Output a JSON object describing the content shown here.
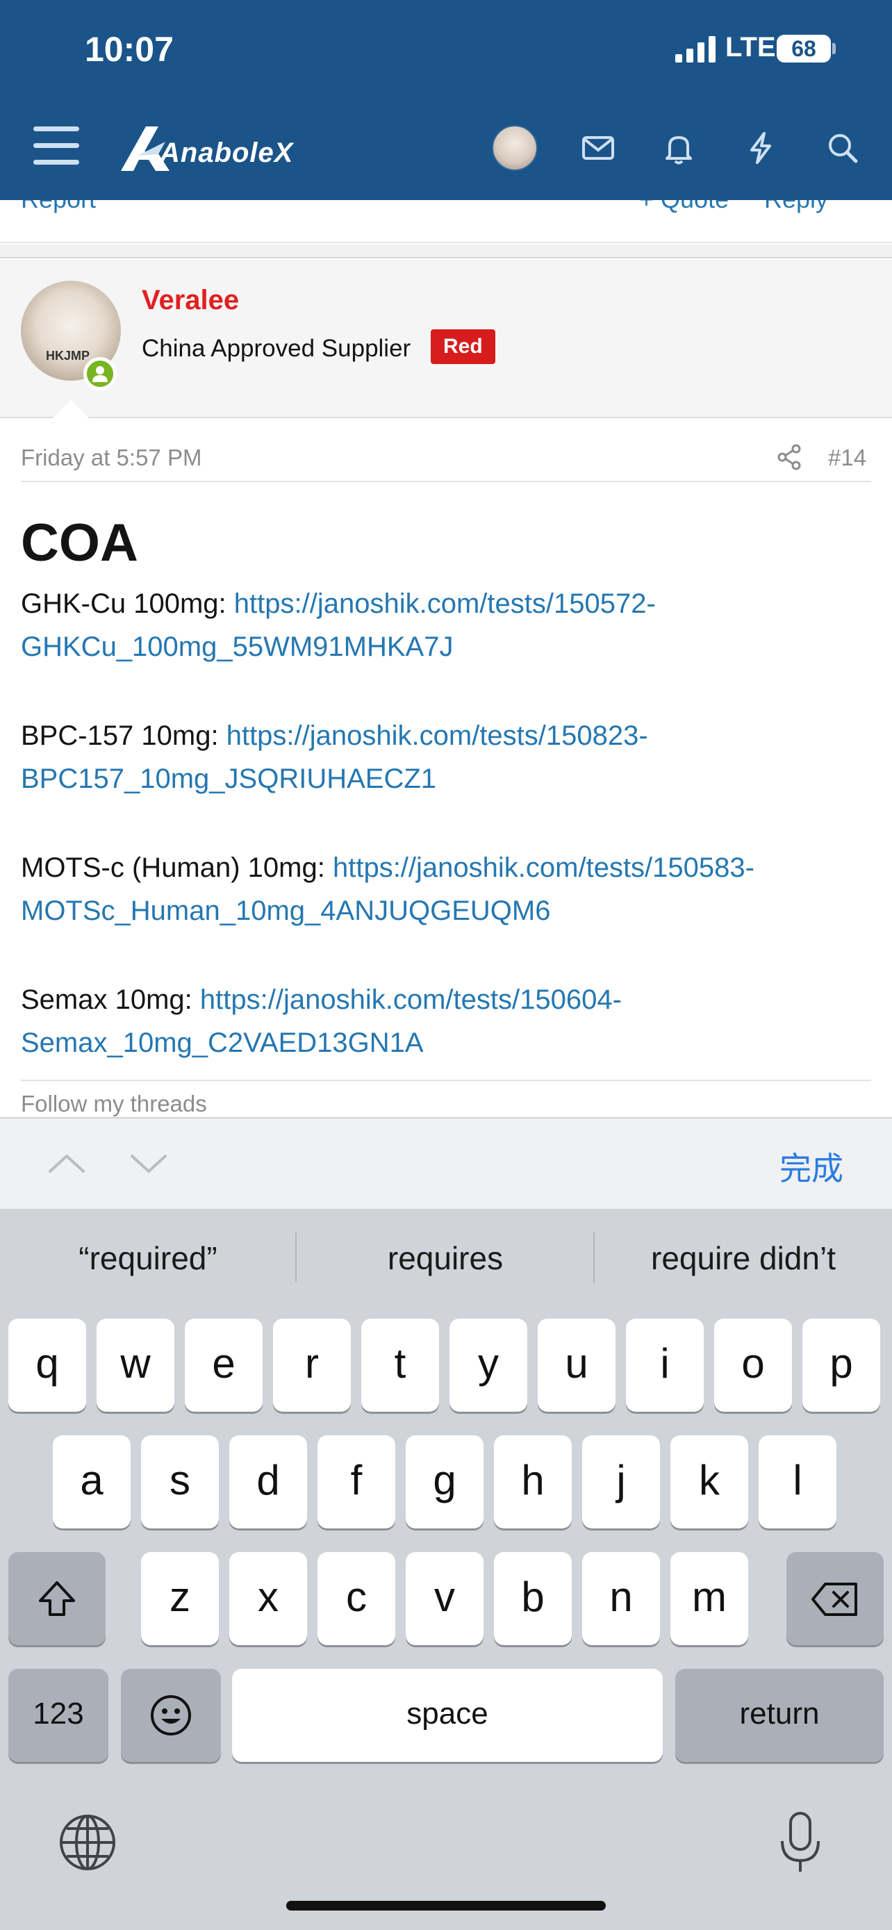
{
  "status_bar": {
    "time": "10:07",
    "network": "LTE",
    "battery": "68"
  },
  "header": {
    "logo_text": "AnaboleX"
  },
  "previous_post": {
    "report": "Report",
    "quote": "+ Quote",
    "reply": "Reply"
  },
  "post": {
    "username": "Veralee",
    "user_title": "China Approved Supplier",
    "badge": "Red",
    "avatar_text": "HKJMP",
    "date": "Friday at 5:57 PM",
    "number": "#14",
    "heading": "COA",
    "items": [
      {
        "label": "GHK-Cu 100mg: ",
        "link_line1": "https://janoshik.com/tests/150572-",
        "link_line2": "GHKCu_100mg_55WM91MHKA7J"
      },
      {
        "label": "BPC-157 10mg: ",
        "link_line1": "https://janoshik.com/tests/150823-",
        "link_line2": "BPC157_10mg_JSQRIUHAECZ1"
      },
      {
        "label": "MOTS-c (Human) 10mg: ",
        "link_line1": "https://janoshik.com/tests/150583-",
        "link_line2": "MOTSc_Human_10mg_4ANJUQGEUQM6"
      },
      {
        "label": "Semax 10mg: ",
        "link_line1": "https://janoshik.com/tests/150604-",
        "link_line2": "Semax_10mg_C2VAED13GN1A"
      }
    ],
    "follow": "Follow my threads"
  },
  "keyboard_toolbar": {
    "done": "完成"
  },
  "suggestions": [
    "“required”",
    "requires",
    "require didn’t"
  ],
  "keyboard": {
    "row1": [
      "q",
      "w",
      "e",
      "r",
      "t",
      "y",
      "u",
      "i",
      "o",
      "p"
    ],
    "row2": [
      "a",
      "s",
      "d",
      "f",
      "g",
      "h",
      "j",
      "k",
      "l"
    ],
    "row3": [
      "z",
      "x",
      "c",
      "v",
      "b",
      "n",
      "m"
    ],
    "numbers": "123",
    "space": "space",
    "return": "return"
  },
  "colors": {
    "header_bg": "#1b5489",
    "link": "#2577b1",
    "username": "#e02020",
    "badge": "#d61c1c",
    "online": "#79b421",
    "done": "#2a7ce0"
  }
}
